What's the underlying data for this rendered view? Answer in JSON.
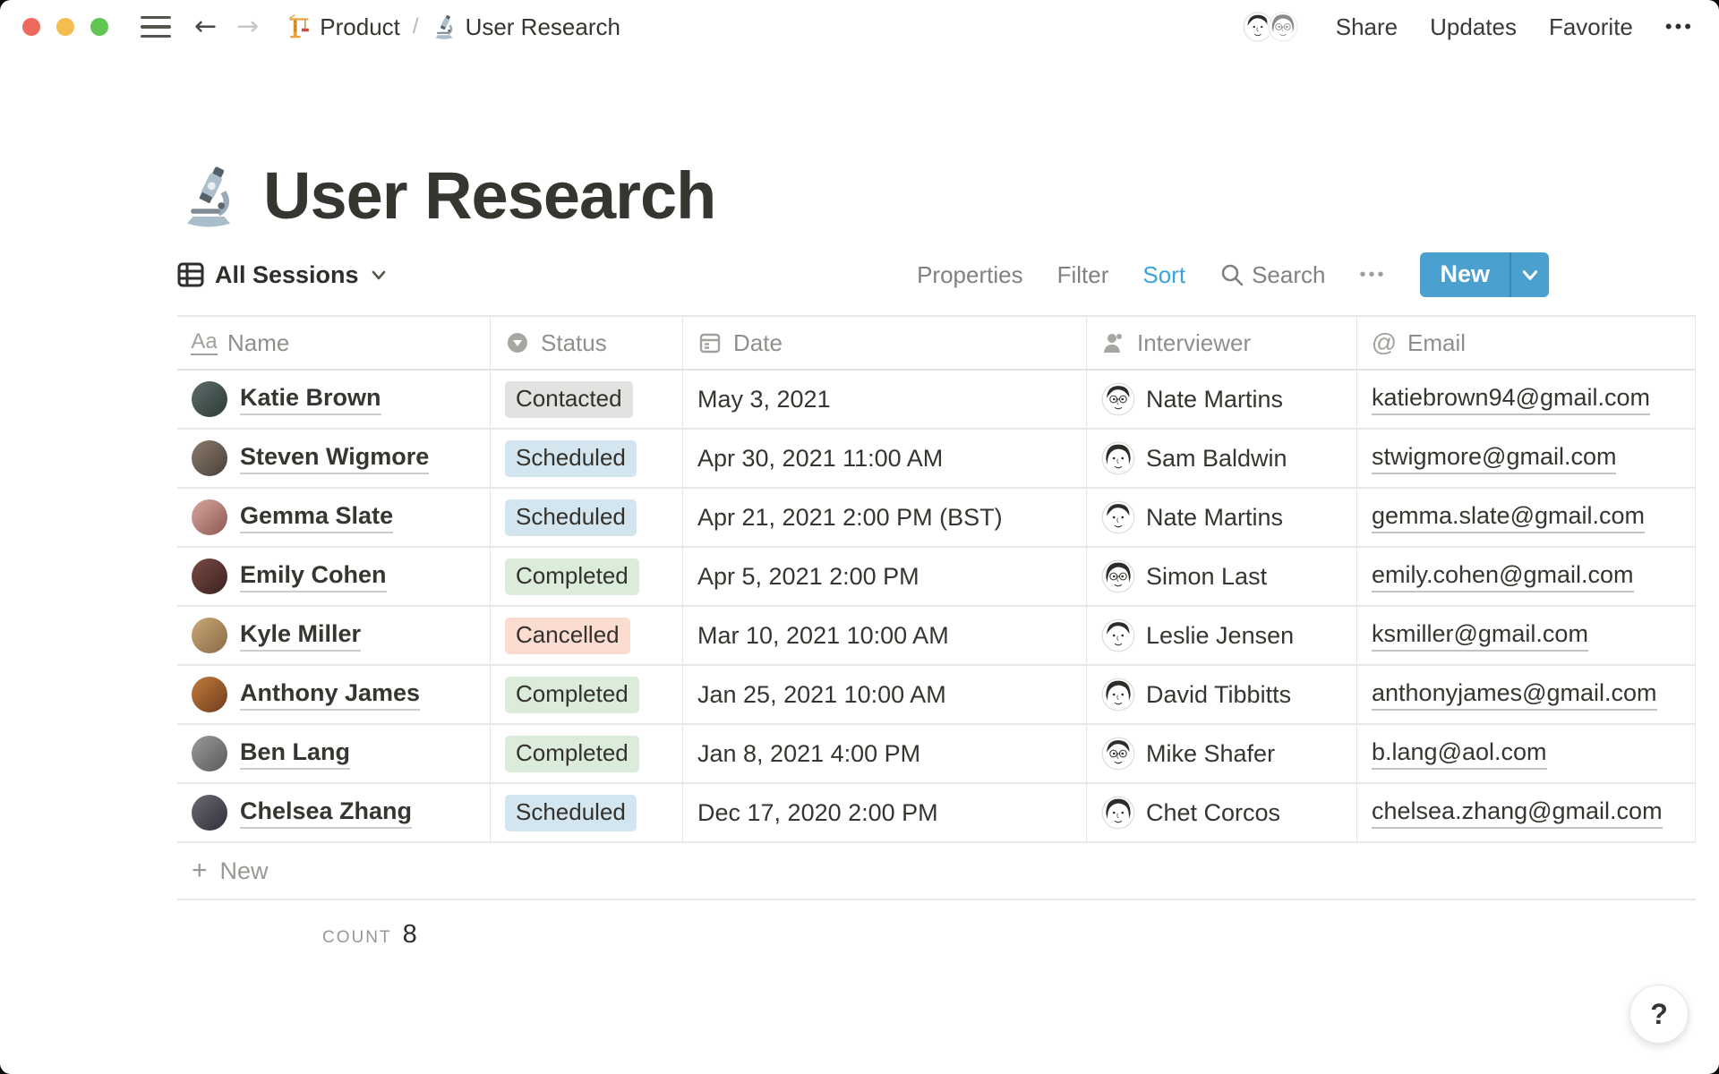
{
  "colors": {
    "accent_blue": "#4AA0CE",
    "sort_blue": "#3CA3DC",
    "status": {
      "gray": "#E3E2E0",
      "blue": "#D3E5EF",
      "green": "#DBECDB",
      "red": "#FADDD0"
    },
    "traffic": {
      "red": "#EE6A5F",
      "yellow": "#F5BD4F",
      "green": "#61C554"
    }
  },
  "topbar": {
    "breadcrumb": {
      "product_label": "Product",
      "separator": "/",
      "page_label": "User Research"
    },
    "share_label": "Share",
    "updates_label": "Updates",
    "favorite_label": "Favorite",
    "more_label": "•••"
  },
  "page": {
    "title": "User Research",
    "icon": "microscope-icon"
  },
  "viewbar": {
    "view_name": "All Sessions",
    "properties_label": "Properties",
    "filter_label": "Filter",
    "sort_label": "Sort",
    "search_label": "Search",
    "more_label": "•••",
    "new_label": "New"
  },
  "table": {
    "columns": [
      {
        "label": "Name",
        "icon": "title-icon",
        "glyph": "Aa"
      },
      {
        "label": "Status",
        "icon": "select-icon"
      },
      {
        "label": "Date",
        "icon": "calendar-icon"
      },
      {
        "label": "Interviewer",
        "icon": "person-icon"
      },
      {
        "label": "Email",
        "icon": "at-icon",
        "glyph": "@"
      }
    ],
    "rows": [
      {
        "name": "Katie Brown",
        "status": "Contacted",
        "status_color": "gray",
        "date": "May 3, 2021",
        "interviewer": "Nate Martins",
        "email": "katiebrown94@gmail.com",
        "avatar": [
          "#5E6E6B",
          "#2C3937"
        ]
      },
      {
        "name": "Steven Wigmore",
        "status": "Scheduled",
        "status_color": "blue",
        "date": "Apr 30, 2021 11:00 AM",
        "interviewer": "Sam Baldwin",
        "email": "stwigmore@gmail.com",
        "avatar": [
          "#8A7A6C",
          "#4A4038"
        ]
      },
      {
        "name": "Gemma Slate",
        "status": "Scheduled",
        "status_color": "blue",
        "date": "Apr 21, 2021 2:00 PM (BST)",
        "interviewer": "Nate Martins",
        "email": "gemma.slate@gmail.com",
        "avatar": [
          "#D9A8A0",
          "#8C5850"
        ]
      },
      {
        "name": "Emily Cohen",
        "status": "Completed",
        "status_color": "green",
        "date": "Apr 5, 2021 2:00 PM",
        "interviewer": "Simon Last",
        "email": "emily.cohen@gmail.com",
        "avatar": [
          "#7A4A44",
          "#3A2220"
        ]
      },
      {
        "name": "Kyle Miller",
        "status": "Cancelled",
        "status_color": "red",
        "date": "Mar 10, 2021 10:00 AM",
        "interviewer": "Leslie Jensen",
        "email": "ksmiller@gmail.com",
        "avatar": [
          "#C9A878",
          "#8A6A45"
        ]
      },
      {
        "name": "Anthony James",
        "status": "Completed",
        "status_color": "green",
        "date": "Jan 25, 2021 10:00 AM",
        "interviewer": "David Tibbitts",
        "email": "anthonyjames@gmail.com",
        "avatar": [
          "#C47A3C",
          "#6E3E1E"
        ]
      },
      {
        "name": "Ben Lang",
        "status": "Completed",
        "status_color": "green",
        "date": "Jan 8, 2021 4:00 PM",
        "interviewer": "Mike Shafer",
        "email": "b.lang@aol.com",
        "avatar": [
          "#9A9A98",
          "#5A5A58"
        ]
      },
      {
        "name": "Chelsea Zhang",
        "status": "Scheduled",
        "status_color": "blue",
        "date": "Dec 17, 2020 2:00 PM",
        "interviewer": "Chet Corcos",
        "email": "chelsea.zhang@gmail.com",
        "avatar": [
          "#6A6A72",
          "#30303A"
        ]
      }
    ],
    "new_row_label": "New",
    "footer": {
      "label": "COUNT",
      "value": "8"
    }
  },
  "help_label": "?"
}
